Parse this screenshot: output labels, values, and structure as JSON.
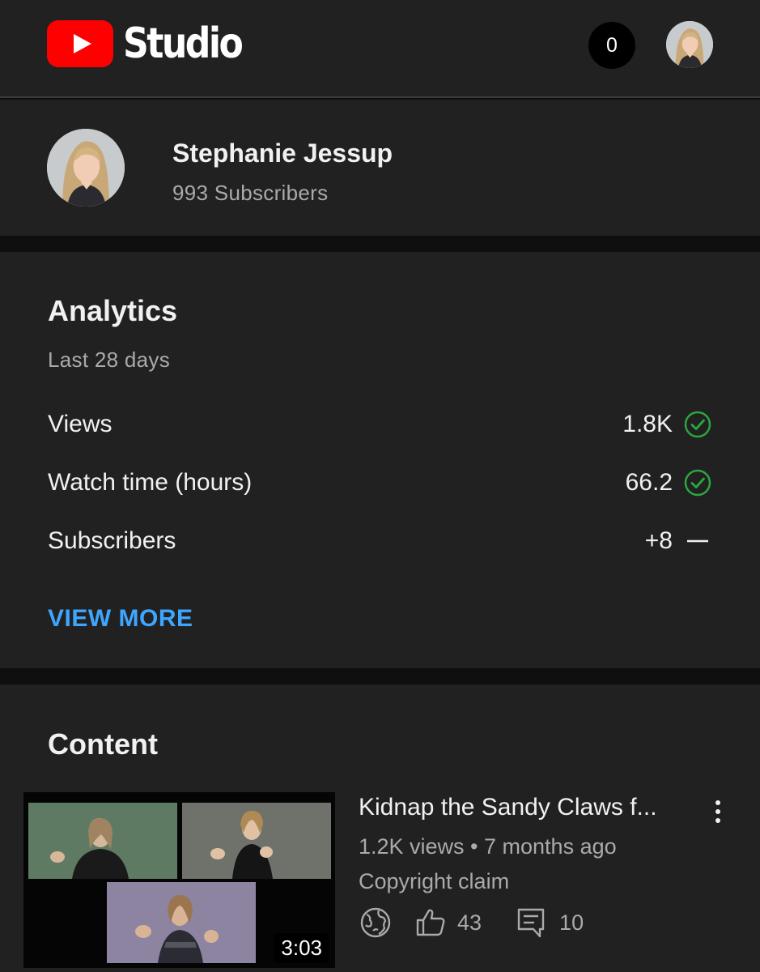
{
  "header": {
    "logo_text": "Studio",
    "notifications_count": "0"
  },
  "channel": {
    "name": "Stephanie Jessup",
    "subscribers": "993 Subscribers"
  },
  "analytics": {
    "title": "Analytics",
    "period": "Last 28 days",
    "metrics": [
      {
        "label": "Views",
        "value": "1.8K",
        "status": "check"
      },
      {
        "label": "Watch time (hours)",
        "value": "66.2",
        "status": "check"
      },
      {
        "label": "Subscribers",
        "value": "+8",
        "status": "dash"
      }
    ],
    "view_more": "VIEW MORE"
  },
  "content": {
    "title": "Content",
    "video": {
      "title": "Kidnap the Sandy Claws f...",
      "duration": "3:03",
      "meta": "1.2K views • 7 months ago",
      "claim": "Copyright claim",
      "likes": "43",
      "comments": "10"
    }
  },
  "colors": {
    "background": "#212121",
    "divider": "#0f0f0f",
    "accent_blue": "#3ea6ff",
    "status_green": "#2ba640",
    "brand_red": "#ff0000"
  }
}
